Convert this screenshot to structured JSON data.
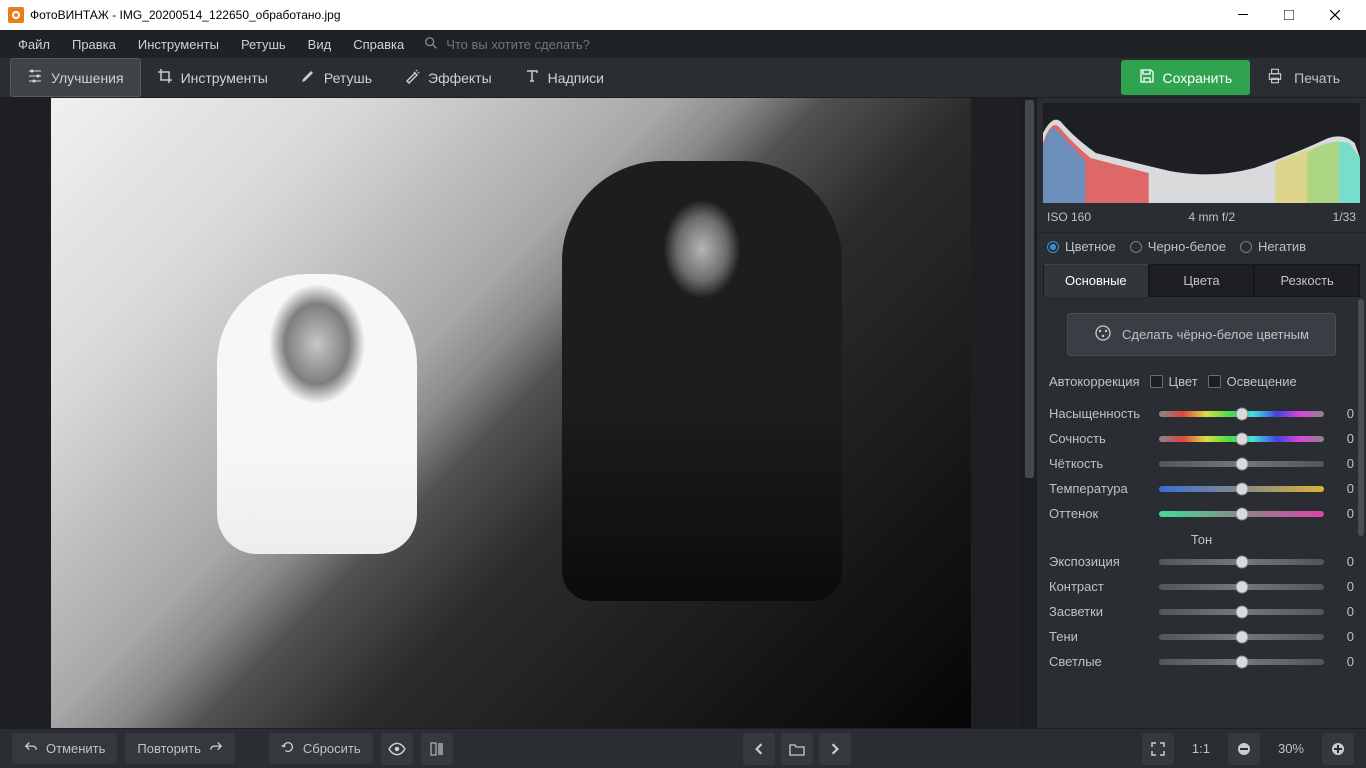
{
  "window": {
    "title": "ФотоВИНТАЖ - IMG_20200514_122650_обработано.jpg"
  },
  "menu": {
    "file": "Файл",
    "edit": "Правка",
    "tools": "Инструменты",
    "retouch": "Ретушь",
    "view": "Вид",
    "help": "Справка",
    "search_placeholder": "Что вы хотите сделать?"
  },
  "tooltabs": {
    "enhance": "Улучшения",
    "tools": "Инструменты",
    "retouch": "Ретушь",
    "effects": "Эффекты",
    "captions": "Надписи"
  },
  "actions": {
    "save": "Сохранить",
    "print": "Печать"
  },
  "meta": {
    "iso": "ISO 160",
    "lens": "4 mm f/2",
    "frame": "1/33"
  },
  "modes": {
    "color": "Цветное",
    "bw": "Черно-белое",
    "negative": "Негатив"
  },
  "tabs": {
    "main": "Основные",
    "colors": "Цвета",
    "sharp": "Резкость"
  },
  "panel": {
    "bw_to_color": "Сделать чёрно-белое цветным",
    "autocorr": "Автокоррекция",
    "check_color": "Цвет",
    "check_light": "Освещение",
    "tone_title": "Тон"
  },
  "sliders": {
    "saturation": {
      "label": "Насыщенность",
      "value": "0"
    },
    "vibrance": {
      "label": "Сочность",
      "value": "0"
    },
    "clarity": {
      "label": "Чёткость",
      "value": "0"
    },
    "temperature": {
      "label": "Температура",
      "value": "0"
    },
    "tint": {
      "label": "Оттенок",
      "value": "0"
    },
    "exposure": {
      "label": "Экспозиция",
      "value": "0"
    },
    "contrast": {
      "label": "Контраст",
      "value": "0"
    },
    "highlights": {
      "label": "Засветки",
      "value": "0"
    },
    "shadows": {
      "label": "Тени",
      "value": "0"
    },
    "whites": {
      "label": "Светлые",
      "value": "0"
    }
  },
  "footer": {
    "undo": "Отменить",
    "redo": "Повторить",
    "reset": "Сбросить",
    "zoom_ratio": "1:1",
    "zoom_pct": "30%"
  }
}
